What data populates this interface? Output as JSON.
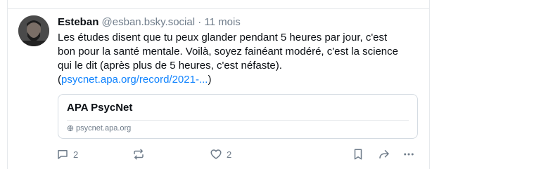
{
  "post": {
    "author_name": "Esteban",
    "handle": "@esban.bsky.social",
    "separator": "·",
    "time_ago": "11 mois",
    "text_line1": "Les études disent que tu peux glander pendant 5 heures par jour, c'est",
    "text_line2": "bon pour la santé mentale. Voilà, soyez fainéant modéré, c'est la science",
    "text_line3": "qui le dit (après plus de 5 heures, c'est néfaste).",
    "link_open": "(",
    "link_text": "psycnet.apa.org/record/2021-...",
    "link_close": ")"
  },
  "card": {
    "title": "APA PsycNet",
    "domain": "psycnet.apa.org"
  },
  "actions": {
    "reply_count": "2",
    "like_count": "2"
  },
  "icons": {
    "reply": "reply-icon",
    "repost": "repost-icon",
    "like": "heart-icon",
    "bookmark": "bookmark-icon",
    "share": "share-icon",
    "more": "more-icon",
    "globe": "globe-icon"
  },
  "colors": {
    "link": "#1083fe",
    "muted": "#6f7c8a"
  }
}
